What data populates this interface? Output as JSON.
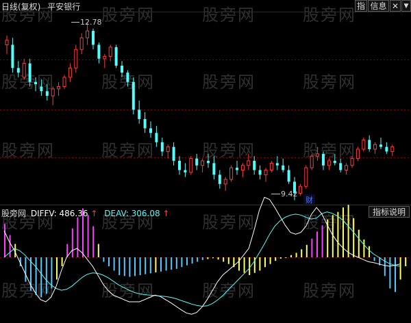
{
  "watermark": "股旁网",
  "header": {
    "period_label": "日线(复权)",
    "stock_name": "平安银行",
    "btn_indicator": "指",
    "btn_info": "信息"
  },
  "price_annotations": {
    "high_label": "12.78",
    "low_label": "9.42",
    "finance_marker": "财"
  },
  "indicator": {
    "source": "股旁网",
    "diffv_label": "DIFFV:",
    "diffv_value": "486.36",
    "deav_label": "DEAV:",
    "deav_value": "306.08",
    "arrow": "↑",
    "explain_button": "指标说明"
  },
  "colors": {
    "up_candle": "#ff3c3c",
    "down_candle": "#54fcfc",
    "hist_magenta": "#ff3cff",
    "hist_yellow": "#ffff54",
    "hist_cyan": "#54c8ff",
    "diffv_line": "#ffffff",
    "deav_line": "#54fcfc",
    "grid_red": "#8b0000"
  },
  "chart_data": {
    "type": "candlestick",
    "price_range": [
      8.9,
      13.0
    ],
    "candles": [
      [
        12.3,
        12.5,
        12.1,
        12.4
      ],
      [
        12.3,
        12.45,
        11.7,
        11.8
      ],
      [
        11.8,
        11.95,
        11.6,
        11.7
      ],
      [
        11.6,
        12.0,
        11.55,
        11.9
      ],
      [
        11.9,
        12.0,
        11.4,
        11.5
      ],
      [
        11.5,
        11.6,
        11.3,
        11.45
      ],
      [
        11.4,
        11.55,
        11.2,
        11.3
      ],
      [
        11.3,
        11.45,
        11.1,
        11.2
      ],
      [
        11.2,
        11.4,
        11.0,
        11.35
      ],
      [
        11.35,
        11.5,
        11.2,
        11.4
      ],
      [
        11.4,
        11.65,
        11.35,
        11.6
      ],
      [
        11.6,
        11.9,
        11.5,
        11.8
      ],
      [
        11.8,
        12.3,
        11.7,
        12.2
      ],
      [
        12.2,
        12.55,
        12.1,
        12.45
      ],
      [
        12.45,
        12.78,
        12.3,
        12.6
      ],
      [
        12.6,
        12.65,
        12.2,
        12.3
      ],
      [
        12.3,
        12.35,
        11.9,
        12.0
      ],
      [
        12.0,
        12.1,
        11.8,
        12.05
      ],
      [
        12.05,
        12.3,
        11.95,
        12.25
      ],
      [
        12.25,
        12.3,
        11.8,
        11.85
      ],
      [
        11.85,
        11.95,
        11.6,
        11.7
      ],
      [
        11.7,
        11.75,
        11.4,
        11.5
      ],
      [
        11.5,
        11.6,
        10.8,
        10.9
      ],
      [
        10.9,
        11.1,
        10.6,
        10.7
      ],
      [
        10.7,
        10.85,
        10.4,
        10.5
      ],
      [
        10.5,
        10.65,
        10.3,
        10.4
      ],
      [
        10.4,
        10.55,
        10.1,
        10.2
      ],
      [
        10.2,
        10.3,
        9.9,
        10.0
      ],
      [
        10.0,
        10.15,
        9.85,
        10.1
      ],
      [
        10.1,
        10.2,
        9.7,
        9.8
      ],
      [
        9.8,
        9.9,
        9.5,
        9.6
      ],
      [
        9.6,
        9.75,
        9.45,
        9.55
      ],
      [
        9.55,
        9.9,
        9.5,
        9.85
      ],
      [
        9.85,
        9.95,
        9.6,
        9.7
      ],
      [
        9.7,
        9.85,
        9.55,
        9.8
      ],
      [
        9.8,
        9.95,
        9.65,
        9.75
      ],
      [
        9.75,
        9.9,
        9.4,
        9.5
      ],
      [
        9.5,
        9.6,
        9.2,
        9.3
      ],
      [
        9.3,
        9.45,
        9.15,
        9.4
      ],
      [
        9.4,
        9.7,
        9.35,
        9.65
      ],
      [
        9.65,
        9.8,
        9.5,
        9.6
      ],
      [
        9.6,
        9.75,
        9.45,
        9.7
      ],
      [
        9.7,
        9.95,
        9.6,
        9.8
      ],
      [
        9.8,
        9.9,
        9.5,
        9.6
      ],
      [
        9.6,
        9.7,
        9.4,
        9.5
      ],
      [
        9.5,
        9.65,
        9.35,
        9.6
      ],
      [
        9.6,
        9.8,
        9.55,
        9.75
      ],
      [
        9.75,
        9.9,
        9.6,
        9.7
      ],
      [
        9.7,
        9.85,
        9.55,
        9.6
      ],
      [
        9.6,
        9.7,
        9.3,
        9.35
      ],
      [
        9.35,
        9.45,
        8.95,
        9.1
      ],
      [
        9.1,
        9.3,
        9.05,
        9.25
      ],
      [
        9.25,
        9.7,
        9.2,
        9.65
      ],
      [
        9.65,
        9.95,
        9.6,
        9.9
      ],
      [
        9.9,
        10.1,
        9.8,
        9.95
      ],
      [
        9.95,
        10.0,
        9.6,
        9.7
      ],
      [
        9.7,
        9.85,
        9.6,
        9.8
      ],
      [
        9.8,
        9.95,
        9.7,
        9.75
      ],
      [
        9.75,
        9.85,
        9.55,
        9.6
      ],
      [
        9.6,
        9.75,
        9.5,
        9.7
      ],
      [
        9.7,
        9.9,
        9.65,
        9.85
      ],
      [
        9.85,
        10.1,
        9.8,
        10.05
      ],
      [
        10.05,
        10.3,
        10.0,
        10.25
      ],
      [
        10.25,
        10.35,
        10.0,
        10.05
      ],
      [
        10.05,
        10.2,
        9.95,
        10.15
      ],
      [
        10.15,
        10.3,
        10.05,
        10.1
      ],
      [
        10.1,
        10.2,
        9.95,
        10.0
      ],
      [
        10.0,
        10.15,
        9.9,
        10.1
      ]
    ]
  },
  "indicator_data": {
    "diffv": [
      60,
      35,
      15,
      -10,
      -35,
      -60,
      -80,
      -95,
      -100,
      -90,
      -65,
      -30,
      0,
      15,
      20,
      10,
      -5,
      -20,
      -40,
      -60,
      -75,
      -85,
      -90,
      -95,
      -100,
      -100,
      -100,
      -95,
      -90,
      -85,
      -88,
      -95,
      -102,
      -110,
      -118,
      -125,
      -128,
      -124,
      -112,
      -95,
      -75,
      -55,
      -40,
      -30,
      -20,
      -10,
      5,
      20,
      60,
      105,
      135,
      130,
      112,
      92,
      72,
      56,
      52,
      56,
      70,
      96,
      112,
      98,
      75,
      52,
      35,
      22,
      12,
      5,
      0,
      -5,
      -10,
      -12,
      -15,
      -18,
      -20,
      -18,
      -15
    ],
    "deav": [
      0,
      10,
      20,
      15,
      5,
      -8,
      -20,
      -35,
      -50,
      -62,
      -70,
      -74,
      -72,
      -65,
      -55,
      -45,
      -38,
      -35,
      -36,
      -40,
      -46,
      -54,
      -62,
      -68,
      -74,
      -79,
      -82,
      -84,
      -85,
      -86,
      -87,
      -88,
      -90,
      -93,
      -97,
      -101,
      -105,
      -108,
      -110,
      -109,
      -104,
      -96,
      -86,
      -74,
      -62,
      -50,
      -38,
      -26,
      -10,
      10,
      30,
      52,
      70,
      82,
      90,
      95,
      97,
      95,
      90,
      86,
      88,
      98,
      102,
      99,
      93,
      84,
      72,
      58,
      44,
      30,
      17,
      7,
      0,
      -8,
      -14,
      -18,
      -20
    ],
    "hist": [
      75,
      50,
      30,
      -20,
      -55,
      -75,
      -85,
      -90,
      -82,
      -70,
      -50,
      -20,
      30,
      65,
      90,
      110,
      95,
      70,
      30,
      -10,
      -20,
      -30,
      -40,
      -42,
      -44,
      -42,
      -40,
      -38,
      -36,
      -34,
      -32,
      -30,
      -28,
      -26,
      -22,
      -18,
      -14,
      -10,
      -6,
      -4,
      -2,
      -5,
      -10,
      -15,
      -22,
      -30,
      -35,
      -40,
      -35,
      -30,
      -22,
      -15,
      -8,
      -3,
      0,
      5,
      10,
      18,
      28,
      42,
      58,
      72,
      85,
      95,
      102,
      112,
      118,
      88,
      62,
      40,
      25,
      -8,
      -18,
      -42,
      -70,
      -78,
      -50,
      -20
    ]
  }
}
